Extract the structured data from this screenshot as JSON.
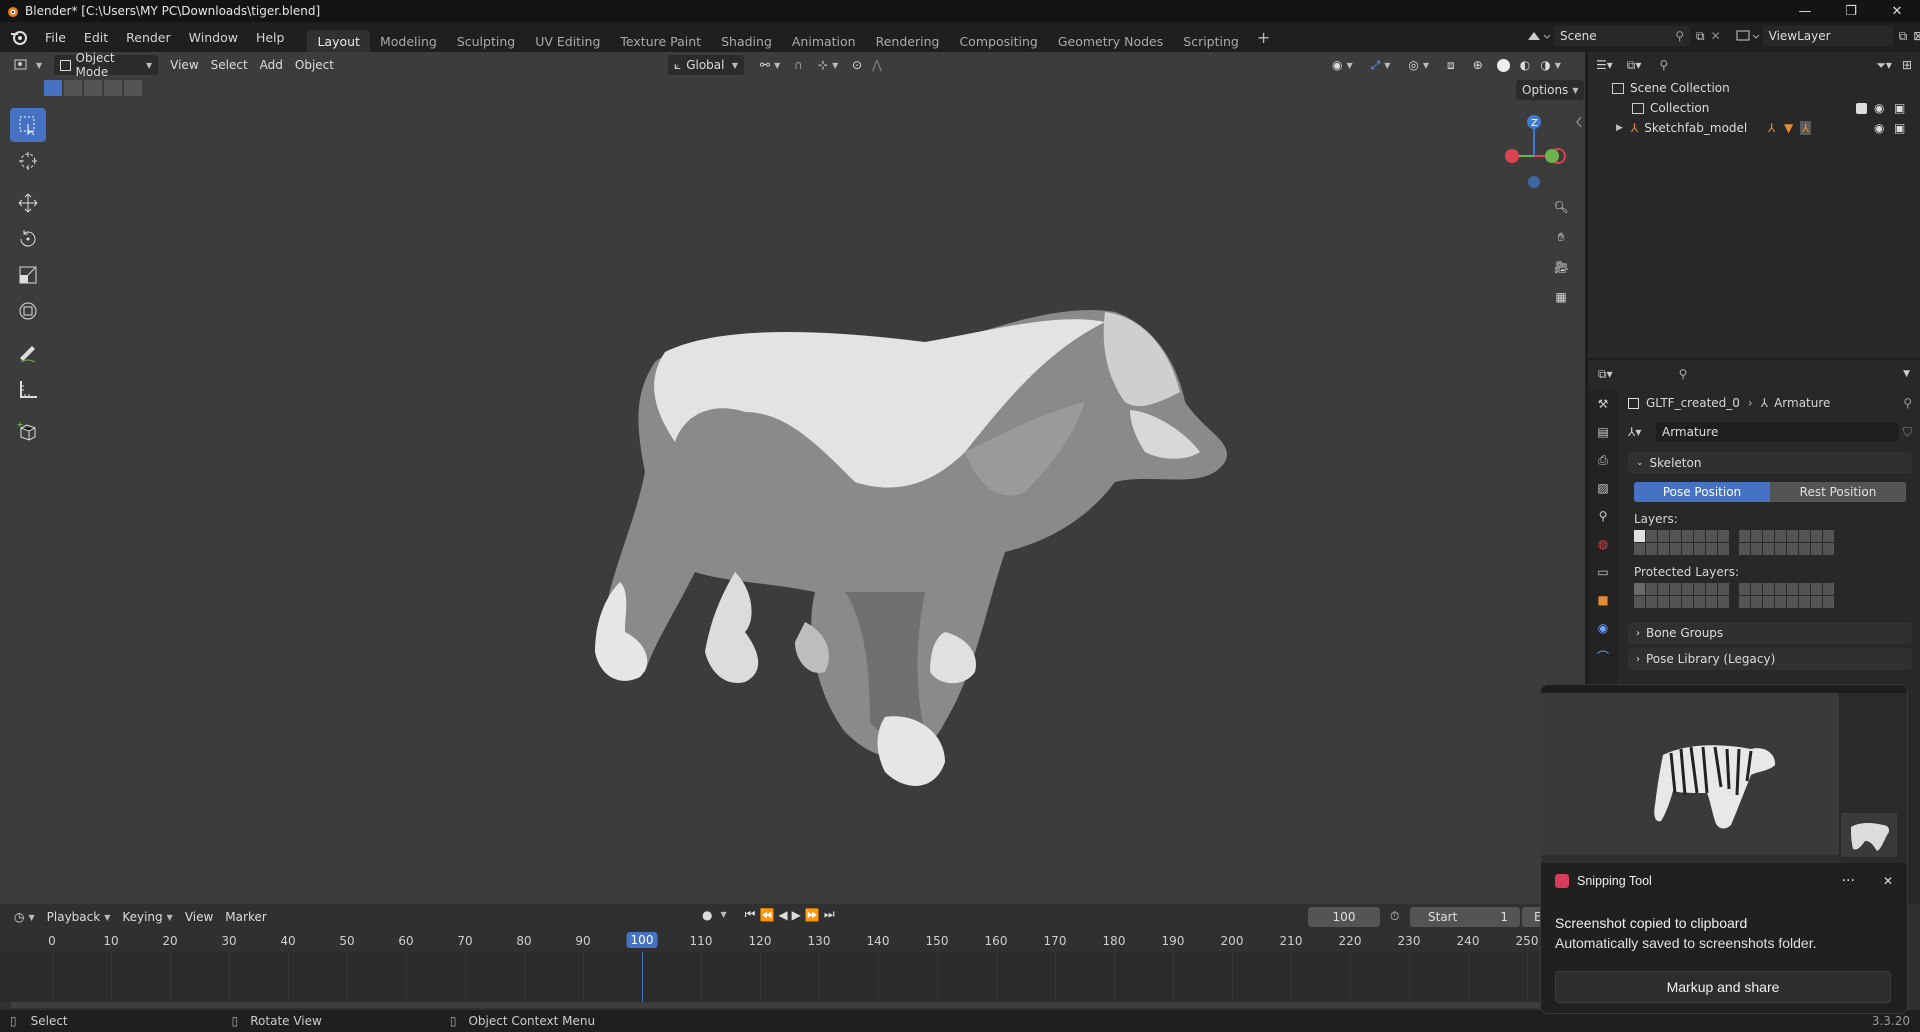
{
  "titlebar": {
    "title": "Blender* [C:\\Users\\MY PC\\Downloads\\tiger.blend]",
    "minimize": "—",
    "maximize": "❐",
    "close": "✕"
  },
  "menu": {
    "file": "File",
    "edit": "Edit",
    "render": "Render",
    "window": "Window",
    "help": "Help"
  },
  "workspaces": [
    "Layout",
    "Modeling",
    "Sculpting",
    "UV Editing",
    "Texture Paint",
    "Shading",
    "Animation",
    "Rendering",
    "Compositing",
    "Geometry Nodes",
    "Scripting"
  ],
  "active_workspace": "Layout",
  "scene": {
    "name": "Scene",
    "view_layer": "ViewLayer"
  },
  "viewport_header": {
    "mode": "Object Mode",
    "view": "View",
    "select": "Select",
    "add": "Add",
    "object": "Object",
    "orientation": "Global",
    "options": "Options"
  },
  "outliner": {
    "scene_collection": "Scene Collection",
    "collection": "Collection",
    "model": "Sketchfab_model"
  },
  "properties": {
    "object_name": "GLTF_created_0",
    "data_name": "Armature",
    "armature_field": "Armature",
    "skeleton": "Skeleton",
    "pose_position": "Pose Position",
    "rest_position": "Rest Position",
    "layers": "Layers:",
    "protected_layers": "Protected Layers:",
    "bone_groups": "Bone Groups",
    "pose_library": "Pose Library (Legacy)"
  },
  "timeline": {
    "playback": "Playback",
    "keying": "Keying",
    "view": "View",
    "marker": "Marker",
    "current_frame": "100",
    "start_label": "Start",
    "start_value": "1",
    "end_label": "End",
    "ticks": [
      "0",
      "10",
      "20",
      "30",
      "40",
      "50",
      "60",
      "70",
      "80",
      "90",
      "100",
      "110",
      "120",
      "130",
      "140",
      "150",
      "160",
      "170",
      "180",
      "190",
      "200",
      "210",
      "220",
      "230",
      "240",
      "250"
    ],
    "current_tick": "100"
  },
  "statusbar": {
    "select": "Select",
    "rotate": "Rotate View",
    "context": "Object Context Menu",
    "version": "3.3.20"
  },
  "toast": {
    "app": "Snipping Tool",
    "more": "···",
    "close": "✕",
    "line1": "Screenshot copied to clipboard",
    "line2": "Automatically saved to screenshots folder.",
    "button": "Markup and share"
  },
  "colors": {
    "accent": "#4672c4",
    "viewport_bg": "#3c3c3c",
    "x_axis": "#d8424f",
    "y_axis": "#6fb34f",
    "z_axis": "#3f7ad0"
  }
}
